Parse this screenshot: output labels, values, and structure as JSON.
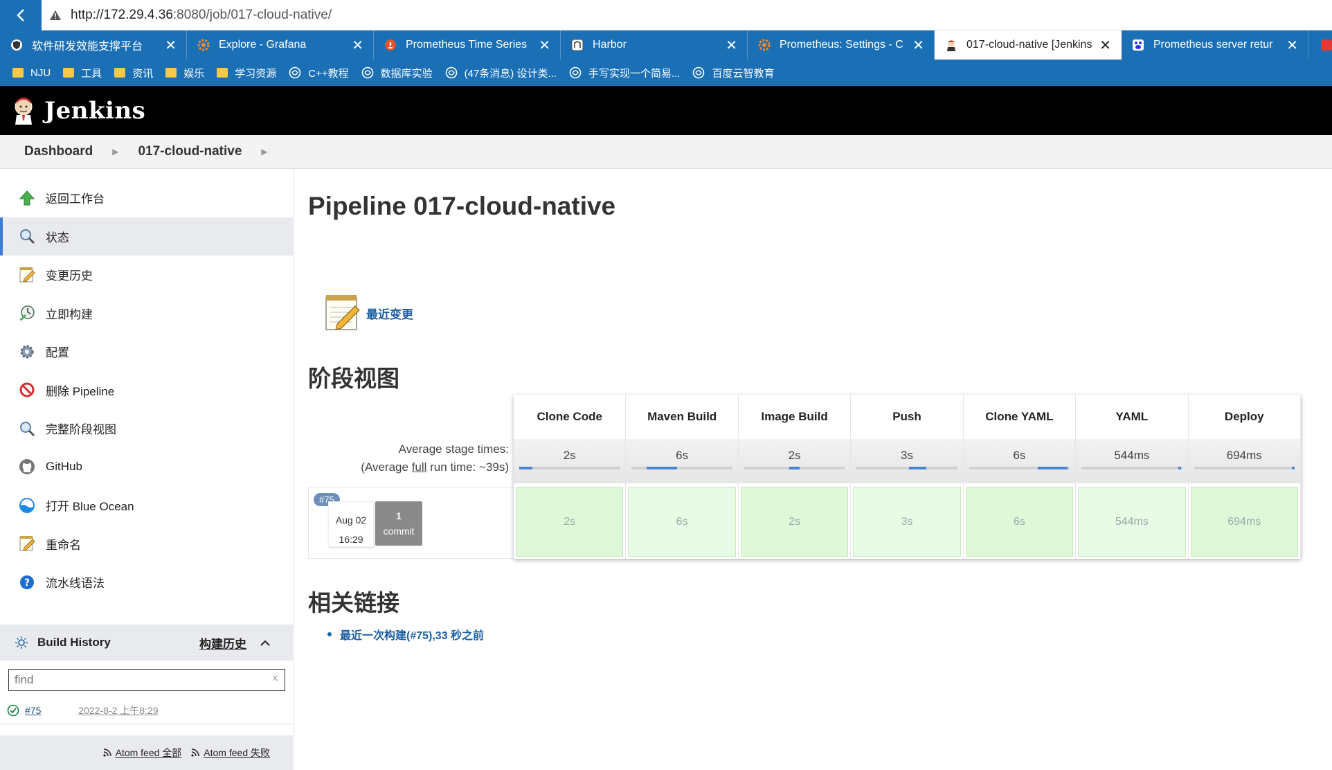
{
  "browser": {
    "url_host": "http://172.29.4.36",
    "url_rest": ":8080/job/017-cloud-native/",
    "tabs": [
      {
        "label": "软件研发效能支撑平台",
        "icon": "shield-icon"
      },
      {
        "label": "Explore - Grafana",
        "icon": "grafana-icon"
      },
      {
        "label": "Prometheus Time Series",
        "icon": "prometheus-icon"
      },
      {
        "label": "Harbor",
        "icon": "harbor-icon"
      },
      {
        "label": "Prometheus: Settings - C",
        "icon": "grafana-icon"
      },
      {
        "label": "017-cloud-native [Jenkins",
        "icon": "jenkins-icon",
        "active": true
      },
      {
        "label": "Prometheus server retur",
        "icon": "baidu-icon"
      }
    ],
    "bookmarks": [
      {
        "label": "NJU",
        "type": "folder"
      },
      {
        "label": "工具",
        "type": "folder"
      },
      {
        "label": "资讯",
        "type": "folder"
      },
      {
        "label": "娱乐",
        "type": "folder"
      },
      {
        "label": "学习资源",
        "type": "folder"
      },
      {
        "label": "C++教程",
        "type": "site"
      },
      {
        "label": "数据库实验",
        "type": "site"
      },
      {
        "label": "(47条消息) 设计类...",
        "type": "site"
      },
      {
        "label": "手写实现一个简易...",
        "type": "site"
      },
      {
        "label": "百度云智教育",
        "type": "site"
      }
    ]
  },
  "header": {
    "brand": "Jenkins"
  },
  "breadcrumb": {
    "dashboard": "Dashboard",
    "job": "017-cloud-native"
  },
  "sidebar": {
    "items": [
      {
        "label": "返回工作台",
        "icon": "up-arrow-icon"
      },
      {
        "label": "状态",
        "icon": "search-icon",
        "active": true
      },
      {
        "label": "变更历史",
        "icon": "notepad-icon"
      },
      {
        "label": "立即构建",
        "icon": "build-clock-icon"
      },
      {
        "label": "配置",
        "icon": "gear-icon"
      },
      {
        "label": "删除 Pipeline",
        "icon": "no-entry-icon"
      },
      {
        "label": "完整阶段视图",
        "icon": "search-icon"
      },
      {
        "label": "GitHub",
        "icon": "github-icon"
      },
      {
        "label": "打开 Blue Ocean",
        "icon": "blue-ocean-icon"
      },
      {
        "label": "重命名",
        "icon": "notepad-icon"
      },
      {
        "label": "流水线语法",
        "icon": "help-icon"
      }
    ],
    "build_history": {
      "title": "Build History",
      "trend": "构建历史",
      "search_placeholder": "find",
      "clear": "x",
      "builds": [
        {
          "number": "#75",
          "date": "2022-8-2 上午8:29",
          "status": "success"
        }
      ],
      "feed_all": "Atom feed 全部",
      "feed_fail": "Atom feed 失败"
    }
  },
  "main": {
    "title": "Pipeline 017-cloud-native",
    "recent_changes": "最近变更",
    "stage_view_title": "阶段视图",
    "avg_label_1": "Average stage times:",
    "avg_label_2_pre": "(Average ",
    "avg_label_2_link": "full",
    "avg_label_2_post": " run time: ~39s)",
    "stages": [
      {
        "name": "Clone Code",
        "avg": "2s",
        "run": "2s",
        "bar_start": 0.0,
        "bar_frac": 0.13
      },
      {
        "name": "Maven Build",
        "avg": "6s",
        "run": "6s",
        "bar_start": 0.15,
        "bar_frac": 0.3
      },
      {
        "name": "Image Build",
        "avg": "2s",
        "run": "2s",
        "bar_start": 0.45,
        "bar_frac": 0.1
      },
      {
        "name": "Push",
        "avg": "3s",
        "run": "3s",
        "bar_start": 0.52,
        "bar_frac": 0.17
      },
      {
        "name": "Clone YAML",
        "avg": "6s",
        "run": "6s",
        "bar_start": 0.68,
        "bar_frac": 0.3
      },
      {
        "name": "YAML",
        "avg": "544ms",
        "run": "544ms",
        "bar_start": 0.96,
        "bar_frac": 0.03
      },
      {
        "name": "Deploy",
        "avg": "694ms",
        "run": "694ms",
        "bar_start": 0.97,
        "bar_frac": 0.03
      }
    ],
    "build": {
      "badge": "#75",
      "date": "Aug 02",
      "time": "16:29",
      "commits": "1",
      "commit_label": "commit"
    },
    "related_title": "相关链接",
    "related_link": "最近一次构建(#75),33 秒之前"
  }
}
